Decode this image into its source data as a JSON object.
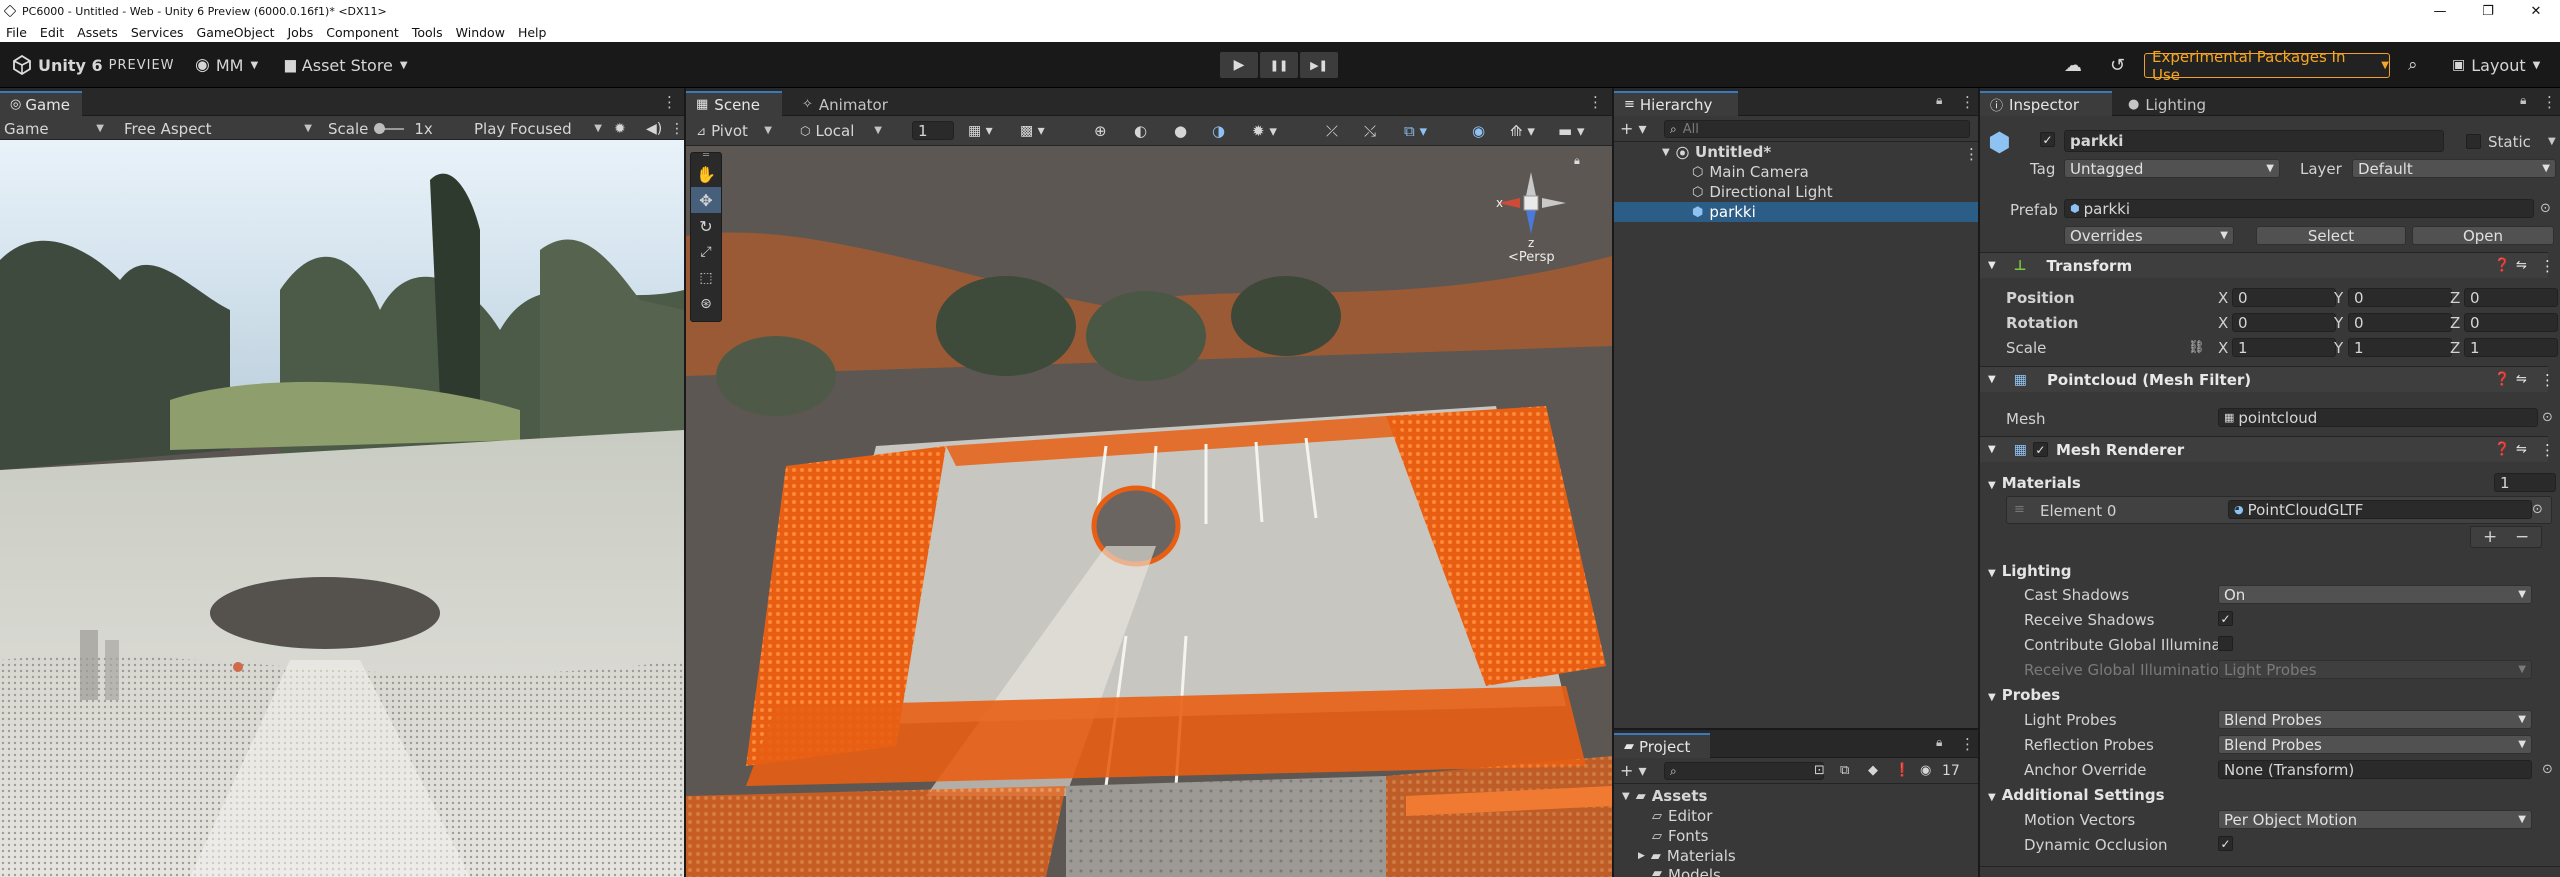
{
  "os": {
    "title": "PC6000 - Untitled - Web - Unity 6 Preview (6000.0.16f1)* <DX11>",
    "controls": [
      "—",
      "❐",
      "✕"
    ]
  },
  "menu": [
    "File",
    "Edit",
    "Assets",
    "Services",
    "GameObject",
    "Jobs",
    "Component",
    "Tools",
    "Window",
    "Help"
  ],
  "toolbar": {
    "brand": "Unity 6",
    "preview": "PREVIEW",
    "account": "MM",
    "asset_store": "Asset Store",
    "play": "▶",
    "pause": "❚❚",
    "step": "▶❚",
    "experimental": "Experimental Packages In Use",
    "layout": "Layout"
  },
  "game": {
    "tab": "Game",
    "display": "Game",
    "aspect": "Free Aspect",
    "scale_label": "Scale",
    "scale_value": "1x",
    "play_mode": "Play Focused"
  },
  "scene": {
    "tab": "Scene",
    "animator_tab": "Animator",
    "pivot": "Pivot",
    "local": "Local",
    "grid_value": "1",
    "persp": "<Persp",
    "gizmo_x": "x",
    "gizmo_z": "z"
  },
  "hierarchy": {
    "tab": "Hierarchy",
    "search_placeholder": "All",
    "scene": "Untitled*",
    "items": [
      "Main Camera",
      "Directional Light",
      "parkki"
    ]
  },
  "project": {
    "tab": "Project",
    "count": "17",
    "root": "Assets",
    "folders": [
      "Editor",
      "Fonts",
      "Materials",
      "Models"
    ]
  },
  "inspector": {
    "tab": "Inspector",
    "lighting_tab": "Lighting",
    "object_name": "parkki",
    "static_label": "Static",
    "tag_label": "Tag",
    "tag_value": "Untagged",
    "layer_label": "Layer",
    "layer_value": "Default",
    "prefab_label": "Prefab",
    "prefab_value": "parkki",
    "overrides": "Overrides",
    "select": "Select",
    "open": "Open",
    "transform": {
      "title": "Transform",
      "position_label": "Position",
      "rotation_label": "Rotation",
      "scale_label": "Scale",
      "position": [
        "0",
        "0",
        "0"
      ],
      "rotation": [
        "0",
        "0",
        "0"
      ],
      "scale": [
        "1",
        "1",
        "1"
      ]
    },
    "mesh_filter": {
      "title": "Pointcloud (Mesh Filter)",
      "mesh_label": "Mesh",
      "mesh_value": "pointcloud"
    },
    "mesh_renderer": {
      "title": "Mesh Renderer",
      "materials_label": "Materials",
      "materials_count": "1",
      "element_label": "Element 0",
      "element_value": "PointCloudGLTF",
      "lighting_header": "Lighting",
      "cast_shadows_label": "Cast Shadows",
      "cast_shadows_value": "On",
      "receive_shadows_label": "Receive Shadows",
      "contribute_gi_label": "Contribute Global Illuminati",
      "receive_gi_label": "Receive Global Illumination",
      "receive_gi_value": "Light Probes",
      "probes_header": "Probes",
      "light_probes_label": "Light Probes",
      "light_probes_value": "Blend Probes",
      "reflection_probes_label": "Reflection Probes",
      "reflection_probes_value": "Blend Probes",
      "anchor_label": "Anchor Override",
      "anchor_value": "None (Transform)",
      "additional_header": "Additional Settings",
      "motion_vectors_label": "Motion Vectors",
      "motion_vectors_value": "Per Object Motion",
      "dynamic_occlusion_label": "Dynamic Occlusion"
    }
  },
  "colors": {
    "accent": "#3a79bb",
    "selection": "#2c5d87",
    "highlight_orange": "#f26a1b",
    "warning": "#f5a623",
    "panel": "#383838",
    "dark": "#191919"
  }
}
